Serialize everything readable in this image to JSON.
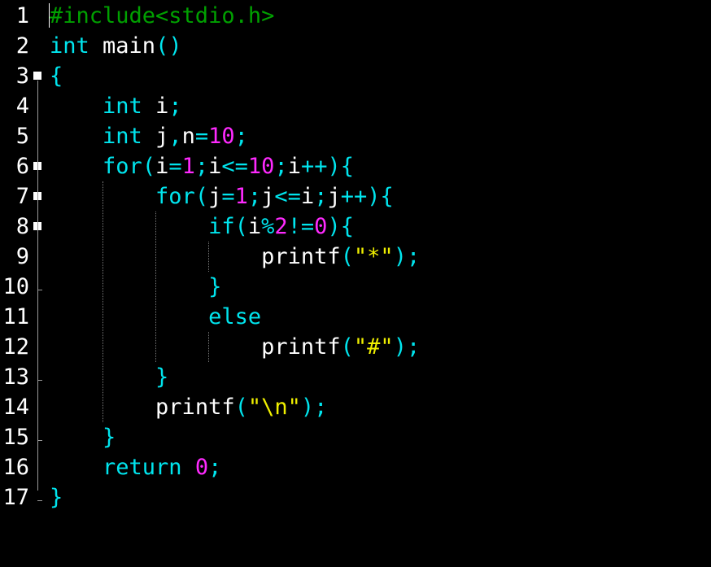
{
  "editor": {
    "lines": [
      {
        "number": "1",
        "fold": false,
        "tokens": [
          {
            "t": "#include<stdio.h>",
            "c": "pp"
          }
        ]
      },
      {
        "number": "2",
        "fold": false,
        "tokens": [
          {
            "t": "int",
            "c": "kw"
          },
          {
            "t": " main",
            "c": "pl"
          },
          {
            "t": "()",
            "c": "op"
          }
        ]
      },
      {
        "number": "3",
        "fold": true,
        "tokens": [
          {
            "t": "{",
            "c": "op"
          }
        ]
      },
      {
        "number": "4",
        "fold": false,
        "tokens": [
          {
            "t": "    ",
            "c": "pl"
          },
          {
            "t": "int",
            "c": "kw"
          },
          {
            "t": " i",
            "c": "pl"
          },
          {
            "t": ";",
            "c": "op"
          }
        ]
      },
      {
        "number": "5",
        "fold": false,
        "tokens": [
          {
            "t": "    ",
            "c": "pl"
          },
          {
            "t": "int",
            "c": "kw"
          },
          {
            "t": " j",
            "c": "pl"
          },
          {
            "t": ",",
            "c": "op"
          },
          {
            "t": "n",
            "c": "pl"
          },
          {
            "t": "=",
            "c": "op"
          },
          {
            "t": "10",
            "c": "num"
          },
          {
            "t": ";",
            "c": "op"
          }
        ]
      },
      {
        "number": "6",
        "fold": true,
        "tokens": [
          {
            "t": "    ",
            "c": "pl"
          },
          {
            "t": "for",
            "c": "kw"
          },
          {
            "t": "(",
            "c": "op"
          },
          {
            "t": "i",
            "c": "pl"
          },
          {
            "t": "=",
            "c": "op"
          },
          {
            "t": "1",
            "c": "num"
          },
          {
            "t": ";",
            "c": "op"
          },
          {
            "t": "i",
            "c": "pl"
          },
          {
            "t": "<=",
            "c": "op"
          },
          {
            "t": "10",
            "c": "num"
          },
          {
            "t": ";",
            "c": "op"
          },
          {
            "t": "i",
            "c": "pl"
          },
          {
            "t": "++){",
            "c": "op"
          }
        ]
      },
      {
        "number": "7",
        "fold": true,
        "tokens": [
          {
            "t": "        ",
            "c": "pl"
          },
          {
            "t": "for",
            "c": "kw"
          },
          {
            "t": "(",
            "c": "op"
          },
          {
            "t": "j",
            "c": "pl"
          },
          {
            "t": "=",
            "c": "op"
          },
          {
            "t": "1",
            "c": "num"
          },
          {
            "t": ";",
            "c": "op"
          },
          {
            "t": "j",
            "c": "pl"
          },
          {
            "t": "<=",
            "c": "op"
          },
          {
            "t": "i",
            "c": "pl"
          },
          {
            "t": ";",
            "c": "op"
          },
          {
            "t": "j",
            "c": "pl"
          },
          {
            "t": "++){",
            "c": "op"
          }
        ]
      },
      {
        "number": "8",
        "fold": true,
        "tokens": [
          {
            "t": "            ",
            "c": "pl"
          },
          {
            "t": "if",
            "c": "kw"
          },
          {
            "t": "(",
            "c": "op"
          },
          {
            "t": "i",
            "c": "pl"
          },
          {
            "t": "%",
            "c": "op"
          },
          {
            "t": "2",
            "c": "num"
          },
          {
            "t": "!=",
            "c": "op"
          },
          {
            "t": "0",
            "c": "num"
          },
          {
            "t": "){",
            "c": "op"
          }
        ]
      },
      {
        "number": "9",
        "fold": false,
        "tokens": [
          {
            "t": "                ",
            "c": "pl"
          },
          {
            "t": "printf",
            "c": "pl"
          },
          {
            "t": "(",
            "c": "op"
          },
          {
            "t": "\"*\"",
            "c": "str"
          },
          {
            "t": ");",
            "c": "op"
          }
        ]
      },
      {
        "number": "10",
        "fold": false,
        "tokens": [
          {
            "t": "            ",
            "c": "pl"
          },
          {
            "t": "}",
            "c": "op"
          }
        ]
      },
      {
        "number": "11",
        "fold": false,
        "tokens": [
          {
            "t": "            ",
            "c": "pl"
          },
          {
            "t": "else",
            "c": "kw"
          }
        ]
      },
      {
        "number": "12",
        "fold": false,
        "tokens": [
          {
            "t": "                ",
            "c": "pl"
          },
          {
            "t": "printf",
            "c": "pl"
          },
          {
            "t": "(",
            "c": "op"
          },
          {
            "t": "\"#\"",
            "c": "str"
          },
          {
            "t": ");",
            "c": "op"
          }
        ]
      },
      {
        "number": "13",
        "fold": false,
        "tokens": [
          {
            "t": "        ",
            "c": "pl"
          },
          {
            "t": "}",
            "c": "op"
          }
        ]
      },
      {
        "number": "14",
        "fold": false,
        "tokens": [
          {
            "t": "        ",
            "c": "pl"
          },
          {
            "t": "printf",
            "c": "pl"
          },
          {
            "t": "(",
            "c": "op"
          },
          {
            "t": "\"\\n\"",
            "c": "str"
          },
          {
            "t": ");",
            "c": "op"
          }
        ]
      },
      {
        "number": "15",
        "fold": false,
        "tokens": [
          {
            "t": "    ",
            "c": "pl"
          },
          {
            "t": "}",
            "c": "op"
          }
        ]
      },
      {
        "number": "16",
        "fold": false,
        "tokens": [
          {
            "t": "    ",
            "c": "pl"
          },
          {
            "t": "return",
            "c": "kw"
          },
          {
            "t": " ",
            "c": "pl"
          },
          {
            "t": "0",
            "c": "num"
          },
          {
            "t": ";",
            "c": "op"
          }
        ]
      },
      {
        "number": "17",
        "fold": false,
        "tokens": [
          {
            "t": "}",
            "c": "op"
          }
        ]
      }
    ],
    "colors": {
      "background": "#000000",
      "keyword": "#00e5ee",
      "preprocessor": "#00a000",
      "number": "#ff2aff",
      "string": "#f0f000",
      "plain": "#ffffff"
    }
  }
}
